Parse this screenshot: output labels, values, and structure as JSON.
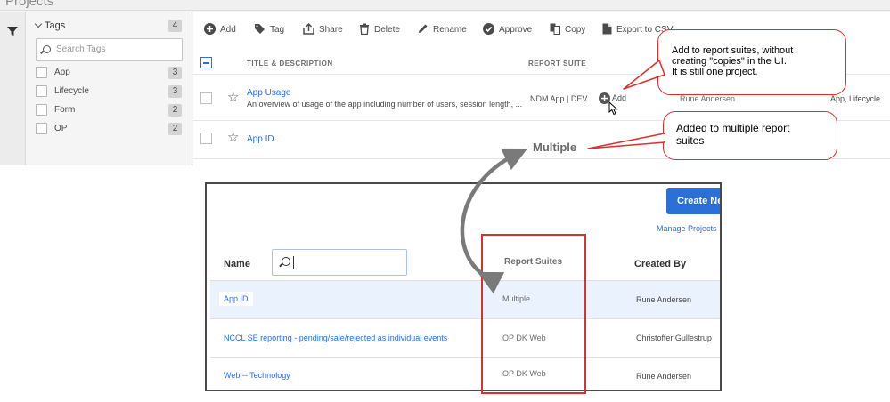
{
  "page": {
    "title": "Projects"
  },
  "tags_panel": {
    "header": "Tags",
    "header_count": "4",
    "search_placeholder": "Search Tags",
    "items": [
      {
        "label": "App",
        "count": "3"
      },
      {
        "label": "Lifecycle",
        "count": "3"
      },
      {
        "label": "Form",
        "count": "2"
      },
      {
        "label": "OP",
        "count": "2"
      }
    ]
  },
  "toolbar": {
    "add": "Add",
    "tag": "Tag",
    "share": "Share",
    "delete": "Delete",
    "rename": "Rename",
    "approve": "Approve",
    "copy": "Copy",
    "export": "Export to CSV"
  },
  "table": {
    "col_title": "TITLE & DESCRIPTION",
    "col_report_suite": "REPORT SUITE",
    "rows": [
      {
        "title": "App Usage",
        "description": "An overview of usage of the app including number of users, session length, ...",
        "report_suite": "NDM App | DEV",
        "add_label": "Add",
        "owner": "Rune Andersen",
        "tags": "App, Lifecycle"
      },
      {
        "title": "App ID",
        "report_suite": "Multiple"
      }
    ]
  },
  "callouts": {
    "top": [
      "Add to report suites, without",
      "creating \"copies\" in the UI.",
      "It is still one project."
    ],
    "bottom": [
      "Added to multiple report",
      "suites"
    ]
  },
  "lower": {
    "create_button": "Create New",
    "manage_link": "Manage Projects",
    "col_name": "Name",
    "col_report_suites": "Report Suites",
    "col_created_by": "Created By",
    "rows": [
      {
        "name": "App ID",
        "report_suites": "Multiple",
        "created_by": "Rune Andersen"
      },
      {
        "name": "NCCL SE reporting - pending/sale/rejected as individual events",
        "report_suites": "OP DK Web",
        "created_by": "Christoffer Gullestrup"
      },
      {
        "name": "Web -- Technology",
        "report_suites": "OP DK Web",
        "created_by": "Rune Andersen"
      }
    ]
  },
  "colors": {
    "accent": "#2c6fd6",
    "callout_border": "#d9312e",
    "arrow": "#7a7a7a"
  }
}
